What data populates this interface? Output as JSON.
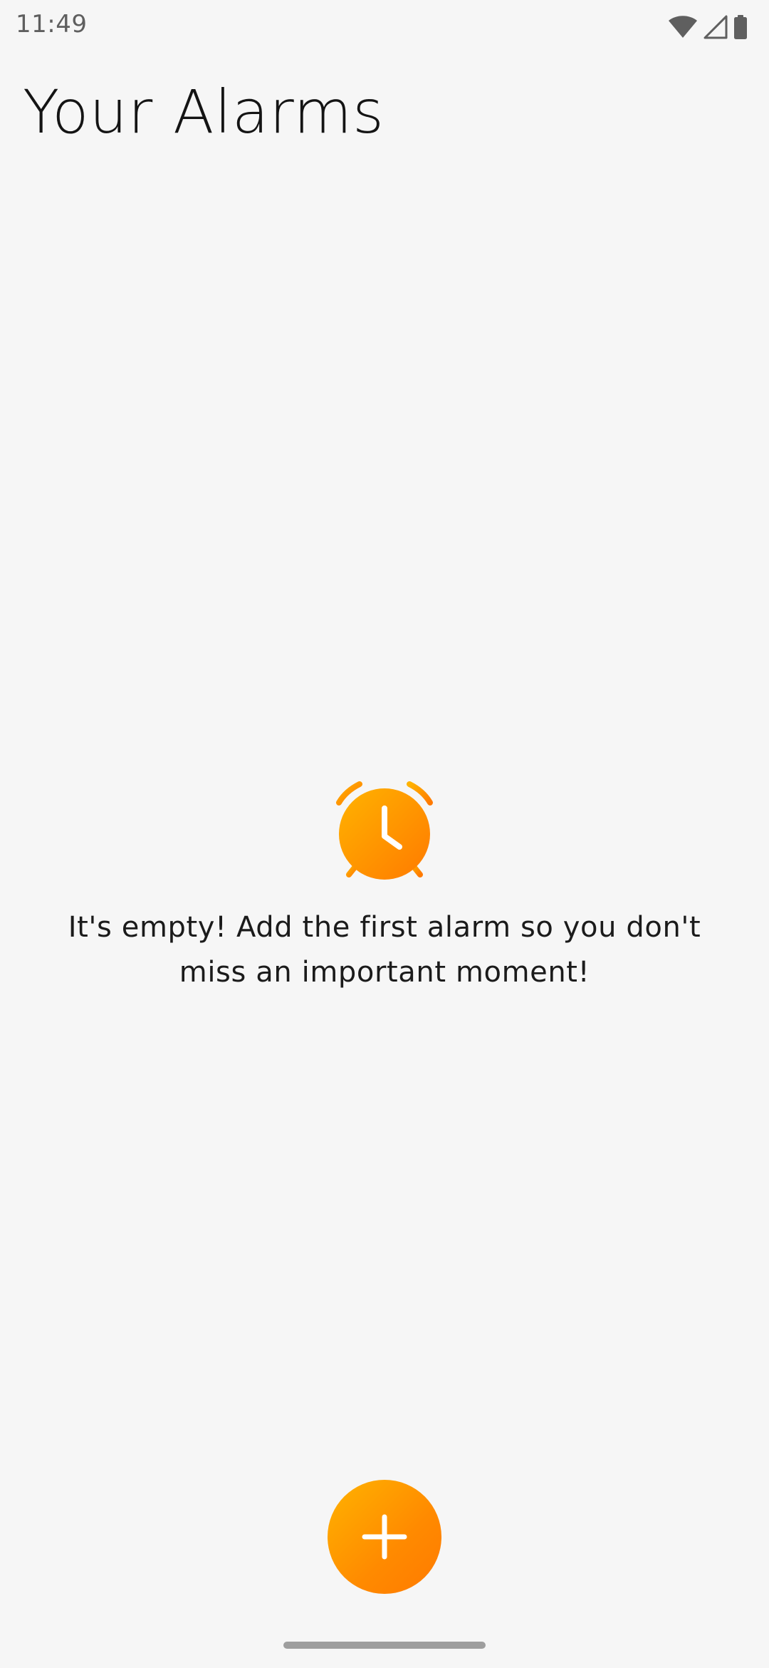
{
  "status_bar": {
    "time": "11:49",
    "icons": [
      "wifi-icon",
      "cellular-signal-icon",
      "battery-icon"
    ]
  },
  "header": {
    "title": "Your Alarms"
  },
  "empty_state": {
    "icon": "alarm-clock-icon",
    "message": "It's empty! Add the first alarm so you don't miss an important moment!"
  },
  "fab": {
    "icon": "plus-icon"
  },
  "colors": {
    "background": "#f6f6f6",
    "accent_start": "#ffb300",
    "accent_end": "#ff7a00",
    "title_text": "#141414",
    "status_text": "#5f5f5f"
  }
}
